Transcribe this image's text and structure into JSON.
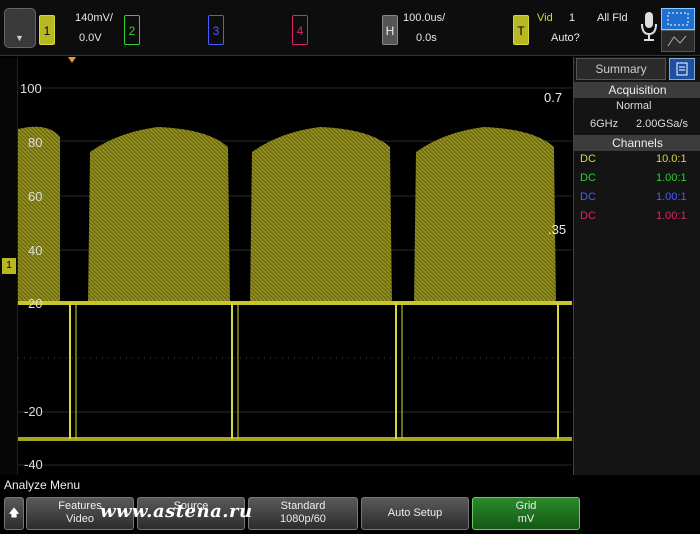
{
  "topbar": {
    "ch1": {
      "label": "1",
      "scale": "140mV/",
      "offset": "0.0V",
      "color": "#d8d83a"
    },
    "ch2": {
      "label": "2",
      "color": "#2fd02f"
    },
    "ch3": {
      "label": "3",
      "color": "#4a5cff"
    },
    "ch4": {
      "label": "4",
      "color": "#e0206a"
    },
    "horizontal": {
      "label": "H",
      "timebase": "100.0us/",
      "delay": "0.0s"
    },
    "trigger": {
      "label": "T",
      "type": "Vid",
      "channel": "1",
      "field": "All Fld",
      "mode": "Auto?"
    }
  },
  "plot": {
    "y_labels": [
      "100",
      "80",
      "60",
      "40",
      "20",
      "-20",
      "-40"
    ],
    "marker_top_right": "0.7",
    "marker_mid_right": ".35",
    "ground_marker": "1"
  },
  "sidepanel": {
    "tab_summary": "Summary",
    "acquisition_header": "Acquisition",
    "acq_mode": "Normal",
    "bandwidth": "6GHz",
    "sample_rate": "2.00GSa/s",
    "channels_header": "Channels",
    "channels": [
      {
        "coupling": "DC",
        "probe": "10.0:1",
        "color": "#d8d83a"
      },
      {
        "coupling": "DC",
        "probe": "1.00:1",
        "color": "#2fd02f"
      },
      {
        "coupling": "DC",
        "probe": "1.00:1",
        "color": "#4a5cff"
      },
      {
        "coupling": "DC",
        "probe": "1.00:1",
        "color": "#e0206a"
      }
    ]
  },
  "bottom": {
    "menu_title": "Analyze Menu",
    "softkeys": [
      {
        "l1": "Features",
        "l2": "Video"
      },
      {
        "l1": "Source",
        "l2": ""
      },
      {
        "l1": "Standard",
        "l2": "1080p/60"
      },
      {
        "l1": "Auto Setup",
        "l2": ""
      },
      {
        "l1": "Grid",
        "l2": "mV"
      }
    ],
    "watermark": "www.astena.ru"
  }
}
